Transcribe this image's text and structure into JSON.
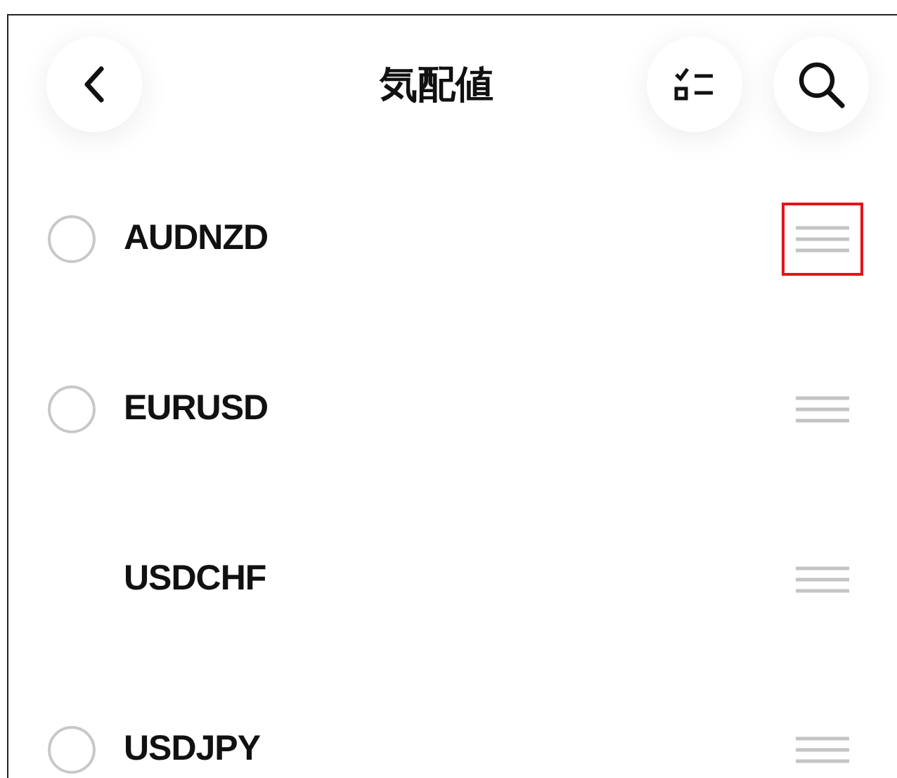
{
  "header": {
    "title": "気配値"
  },
  "rows": [
    {
      "symbol": "AUDNZD",
      "kind": "selectable",
      "checked": false,
      "highlighted": true
    },
    {
      "symbol": "EURUSD",
      "kind": "selectable",
      "checked": false,
      "highlighted": false
    },
    {
      "symbol": "USDCHF",
      "kind": "fixed",
      "highlighted": false
    },
    {
      "symbol": "USDJPY",
      "kind": "selectable",
      "checked": false,
      "highlighted": false
    }
  ]
}
